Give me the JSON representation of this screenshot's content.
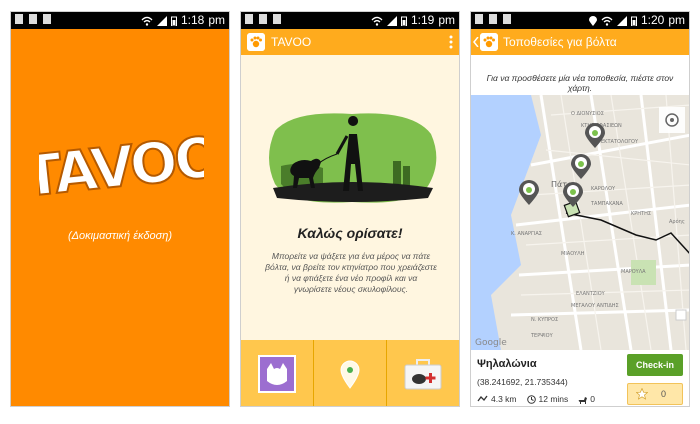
{
  "status": {
    "screen1_time": "1:18",
    "screen2_time": "1:19",
    "screen3_time": "1:20",
    "am_pm": "pm"
  },
  "splash": {
    "logo_text": "TAVOO",
    "subtitle": "(Δοκιμαστική έκδοση)",
    "background_color": "#ff8a00"
  },
  "app": {
    "title": "TAVOO",
    "accent": "#ffab1d"
  },
  "welcome": {
    "title": "Καλώς ορίσατε!",
    "text": "Μπορείτε να ψάξετε για ένα μέρος να πάτε βόλτα, να βρείτε τον κτηνίατρο που χρειάζεστε ή να φτιάξετε ένα νέο προφίλ και να γνωρίσετε νέους σκυλοφίλους.",
    "nav": [
      "profile",
      "locations",
      "vet"
    ]
  },
  "map_screen": {
    "title": "Τοποθεσίες για βόλτα",
    "hint": "Για να προσθέσετε μία νέα τοποθεσία, πιέστε στον χάρτη.",
    "map_labels": [
      "Ο ΔΙΟΝΥΣΙΟΣ",
      "ΚΤΗΣ ΣΦΑΣΙΕΩΝ",
      "ΕΚΤΑΤΟΛΟΓΟΥ",
      "Πάτρα",
      "ΚΑΡΟΛΟΥ",
      "ΤΑΜΠΑΚΑΝΑ",
      "ΚΡΗΤΗΣ",
      "Αρόης",
      "Κ. ΑΝΑΡΓΙΑΣ",
      "ΜΙΑΟΥΛΗ",
      "ΜΑΡΟΥΛΑ",
      "ΕΛΑΝΤΖΙΟΥ",
      "ΜΕΓΑΛΟΥ ΑΝΤΙΔΗΣ",
      "Ν. ΚΥΠΡΟΣ",
      "ΤΕΡΨΙΟΥ",
      "Google"
    ],
    "place": {
      "name": "Ψηλαλώνια",
      "coords": "(38.241692, 21.735344)",
      "distance": "4.3 km",
      "time": "12 mins",
      "dogs": "0",
      "checkin_label": "Check-in",
      "rating": "0"
    }
  }
}
